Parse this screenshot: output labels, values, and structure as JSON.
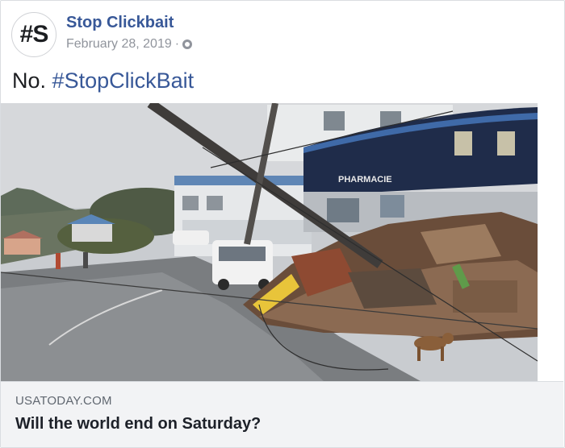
{
  "post": {
    "avatar_text": "#S",
    "page_name": "Stop Clickbait",
    "date": "February 28, 2019",
    "separator": "·",
    "privacy_icon": "globe-icon",
    "text_plain": "No.",
    "hashtag": "#StopClickBait"
  },
  "photo": {
    "sign_text": "PHARMACIE",
    "close_icon": "close-icon",
    "close_glyph": "×"
  },
  "link": {
    "domain": "USATODAY.COM",
    "headline": "Will the world end on Saturday?"
  },
  "colors": {
    "link_blue": "#385898",
    "meta_gray": "#90949c",
    "link_box_bg": "#f2f3f5"
  }
}
